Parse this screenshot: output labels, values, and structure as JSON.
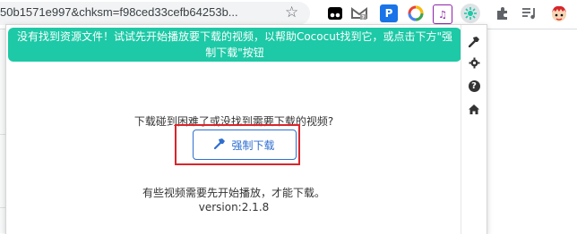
{
  "browser": {
    "url": "50b1571e997&chksm=f98ced33cefb64253b...",
    "bookmark_icon": "star-icon"
  },
  "extensions": {
    "items": [
      {
        "name": "tampermonkey-icon",
        "glyph": "●●",
        "color": "#000000"
      },
      {
        "name": "gmail-icon",
        "glyph": "M",
        "color": "#5f6368"
      },
      {
        "name": "p-icon",
        "glyph": "P",
        "color": "#1a73e8"
      },
      {
        "name": "color-wheel-icon",
        "glyph": "◎",
        "color": "#ea4335"
      },
      {
        "name": "music-icon",
        "glyph": "♫",
        "color": "#8e24aa"
      },
      {
        "name": "cococut-icon",
        "glyph": "✺",
        "color": "#1dc9a6"
      },
      {
        "name": "puzzle-icon",
        "glyph": "✚",
        "color": "#5f6368"
      },
      {
        "name": "playlist-icon",
        "glyph": "≡♪",
        "color": "#5f6368"
      },
      {
        "name": "avatar-icon",
        "glyph": "☺",
        "color": "#d8262b"
      }
    ]
  },
  "popup": {
    "notice": "没有找到资源文件！试试先开始播放要下载的视频，以帮助Cococut找到它，或点击下方\"强制下载\"按钮",
    "prompt": "下载碰到困难了或没找到需要下载的视频?",
    "force_download_label": "强制下载",
    "hint": "有些视频需要先开始播放，才能下载。",
    "version": "version:2.1.8",
    "accent": "#1dc9a6",
    "button_color": "#2f6fd0",
    "highlight_color": "#d8262b"
  },
  "sidebar": {
    "items": [
      {
        "name": "hammer-icon",
        "glyph": "⚒"
      },
      {
        "name": "gear-icon",
        "glyph": "⚙"
      },
      {
        "name": "help-icon",
        "glyph": "?"
      },
      {
        "name": "home-icon",
        "glyph": "⌂"
      }
    ]
  }
}
